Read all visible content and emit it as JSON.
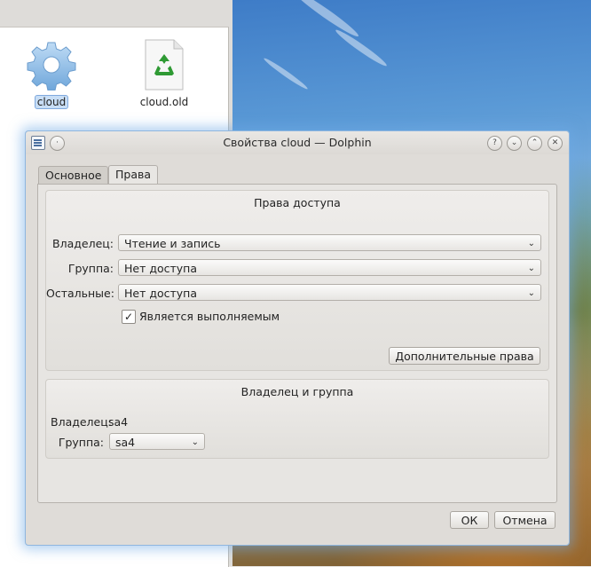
{
  "file_manager": {
    "files": [
      {
        "name": "cloud",
        "icon": "gear-icon",
        "selected": true
      },
      {
        "name": "cloud.old",
        "icon": "recycle-icon",
        "selected": false
      }
    ]
  },
  "dialog": {
    "title": "Свойства cloud — Dolphin",
    "titlebar_buttons": [
      "help-button",
      "minimize-button",
      "maximize-button",
      "close-button"
    ],
    "tabs": [
      {
        "label": "Основное",
        "active": false
      },
      {
        "label": "Права",
        "active": true
      }
    ],
    "access": {
      "title": "Права доступа",
      "owner_label": "Владелец:",
      "owner_value": "Чтение и запись",
      "group_label": "Группа:",
      "group_value": "Нет доступа",
      "others_label": "Остальные:",
      "others_value": "Нет доступа",
      "executable_label": "Является выполняемым",
      "executable_checked": true,
      "advanced_button": "Дополнительные права"
    },
    "ownership": {
      "title": "Владелец и группа",
      "owner_label": "Владелец:",
      "owner_value": "sa4",
      "group_label": "Группа:",
      "group_value": "sa4"
    },
    "ok_button": "ОК",
    "cancel_button": "Отмена"
  },
  "colors": {
    "selection": "#c8def6",
    "focus_glow": "#8fb6de",
    "dialog_bg": "#dfdcd8"
  }
}
